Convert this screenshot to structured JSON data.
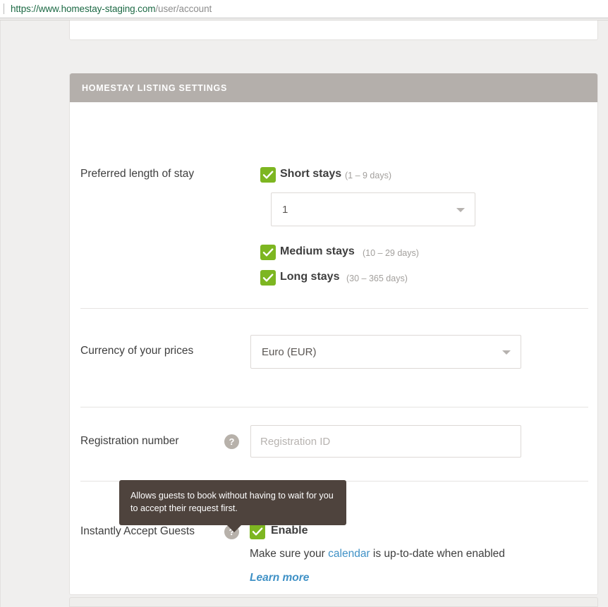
{
  "browser": {
    "url_host": "https://www.homestay-staging.com",
    "url_path": "/user/account"
  },
  "card": {
    "header_title": "HOMESTAY LISTING SETTINGS"
  },
  "preferred_length": {
    "label": "Preferred length of stay",
    "options": [
      {
        "label": "Short stays",
        "hint": "(1 – 9 days)",
        "checked": true
      },
      {
        "label": "Medium stays",
        "hint": "(10 – 29 days)",
        "checked": true
      },
      {
        "label": "Long stays",
        "hint": "(30 – 365 days)",
        "checked": true
      }
    ],
    "short_stay_select_value": "1"
  },
  "currency": {
    "label": "Currency of your prices",
    "value": "Euro (EUR)"
  },
  "registration": {
    "label": "Registration number",
    "help_icon": "question-mark-icon",
    "placeholder": "Registration ID",
    "value": ""
  },
  "instant_accept": {
    "label": "Instantly Accept Guests",
    "help_icon": "question-mark-icon",
    "tooltip": "Allows guests to book without having to wait for you to accept their request first.",
    "enable_label": "Enable",
    "enable_checked": true,
    "note_before": "Make sure your ",
    "note_link": "calendar",
    "note_after": " is up-to-date when enabled",
    "learn_more": "Learn more"
  },
  "colors": {
    "checkbox_green": "#7db621",
    "header_gray": "#b4afab",
    "tooltip_brown": "#4e433d",
    "link_blue": "#3f91c6",
    "help_icon_gray": "#b7b1aa"
  }
}
